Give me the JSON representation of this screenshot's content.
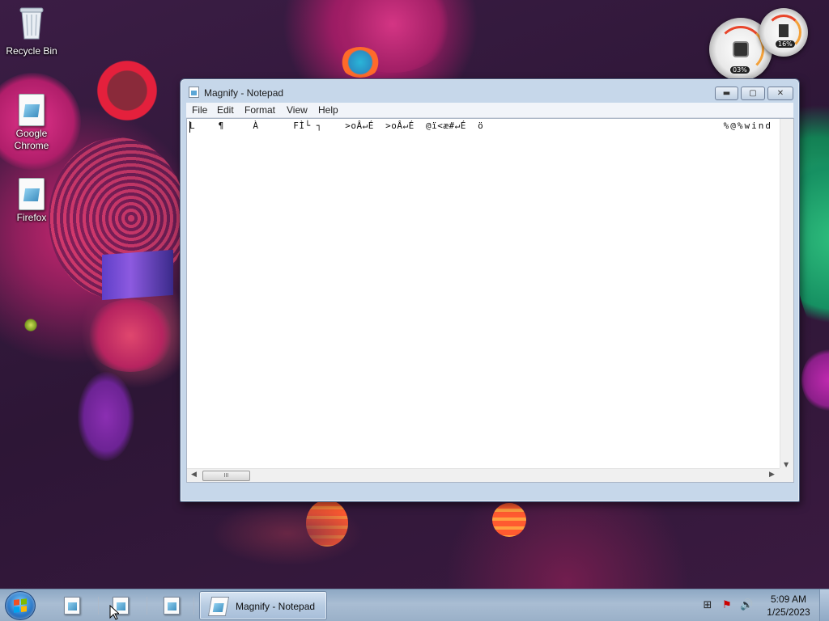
{
  "desktop": {
    "icons": [
      {
        "label": "Recycle Bin",
        "icon": "recycle-bin-icon"
      },
      {
        "label": "Google Chrome",
        "icon": "document-shortcut-icon"
      },
      {
        "label": "Firefox",
        "icon": "document-shortcut-icon"
      }
    ]
  },
  "gadgets": {
    "cpu_readout": "03%",
    "memory_readout": "16%"
  },
  "window": {
    "title": "Magnify - Notepad",
    "buttons": {
      "minimize": "▬",
      "maximize": "▢",
      "close": "✕"
    },
    "menu": [
      "File",
      "Edit",
      "Format",
      "View",
      "Help"
    ],
    "content_left": "L    ¶     À      FÌ└ ┐    >oÂ↵É  >oÂ↵É  @ï<æ#↵É  ö",
    "content_right": "%@%wind",
    "scroll_thumb": "III"
  },
  "taskbar": {
    "start_icon": "windows-start-orb",
    "pinned": [
      "notepad-icon",
      "notepad-icon",
      "notepad-icon"
    ],
    "active_task": "Magnify - Notepad",
    "tray": [
      "network-icon",
      "action-center-flag-icon",
      "volume-icon"
    ],
    "time": "5:09 AM",
    "date": "1/25/2023"
  },
  "colors": {
    "taskbar": "#9ab0c8",
    "window_frame": "#c6d7ea",
    "wallpaper_base": "#2d1636"
  }
}
